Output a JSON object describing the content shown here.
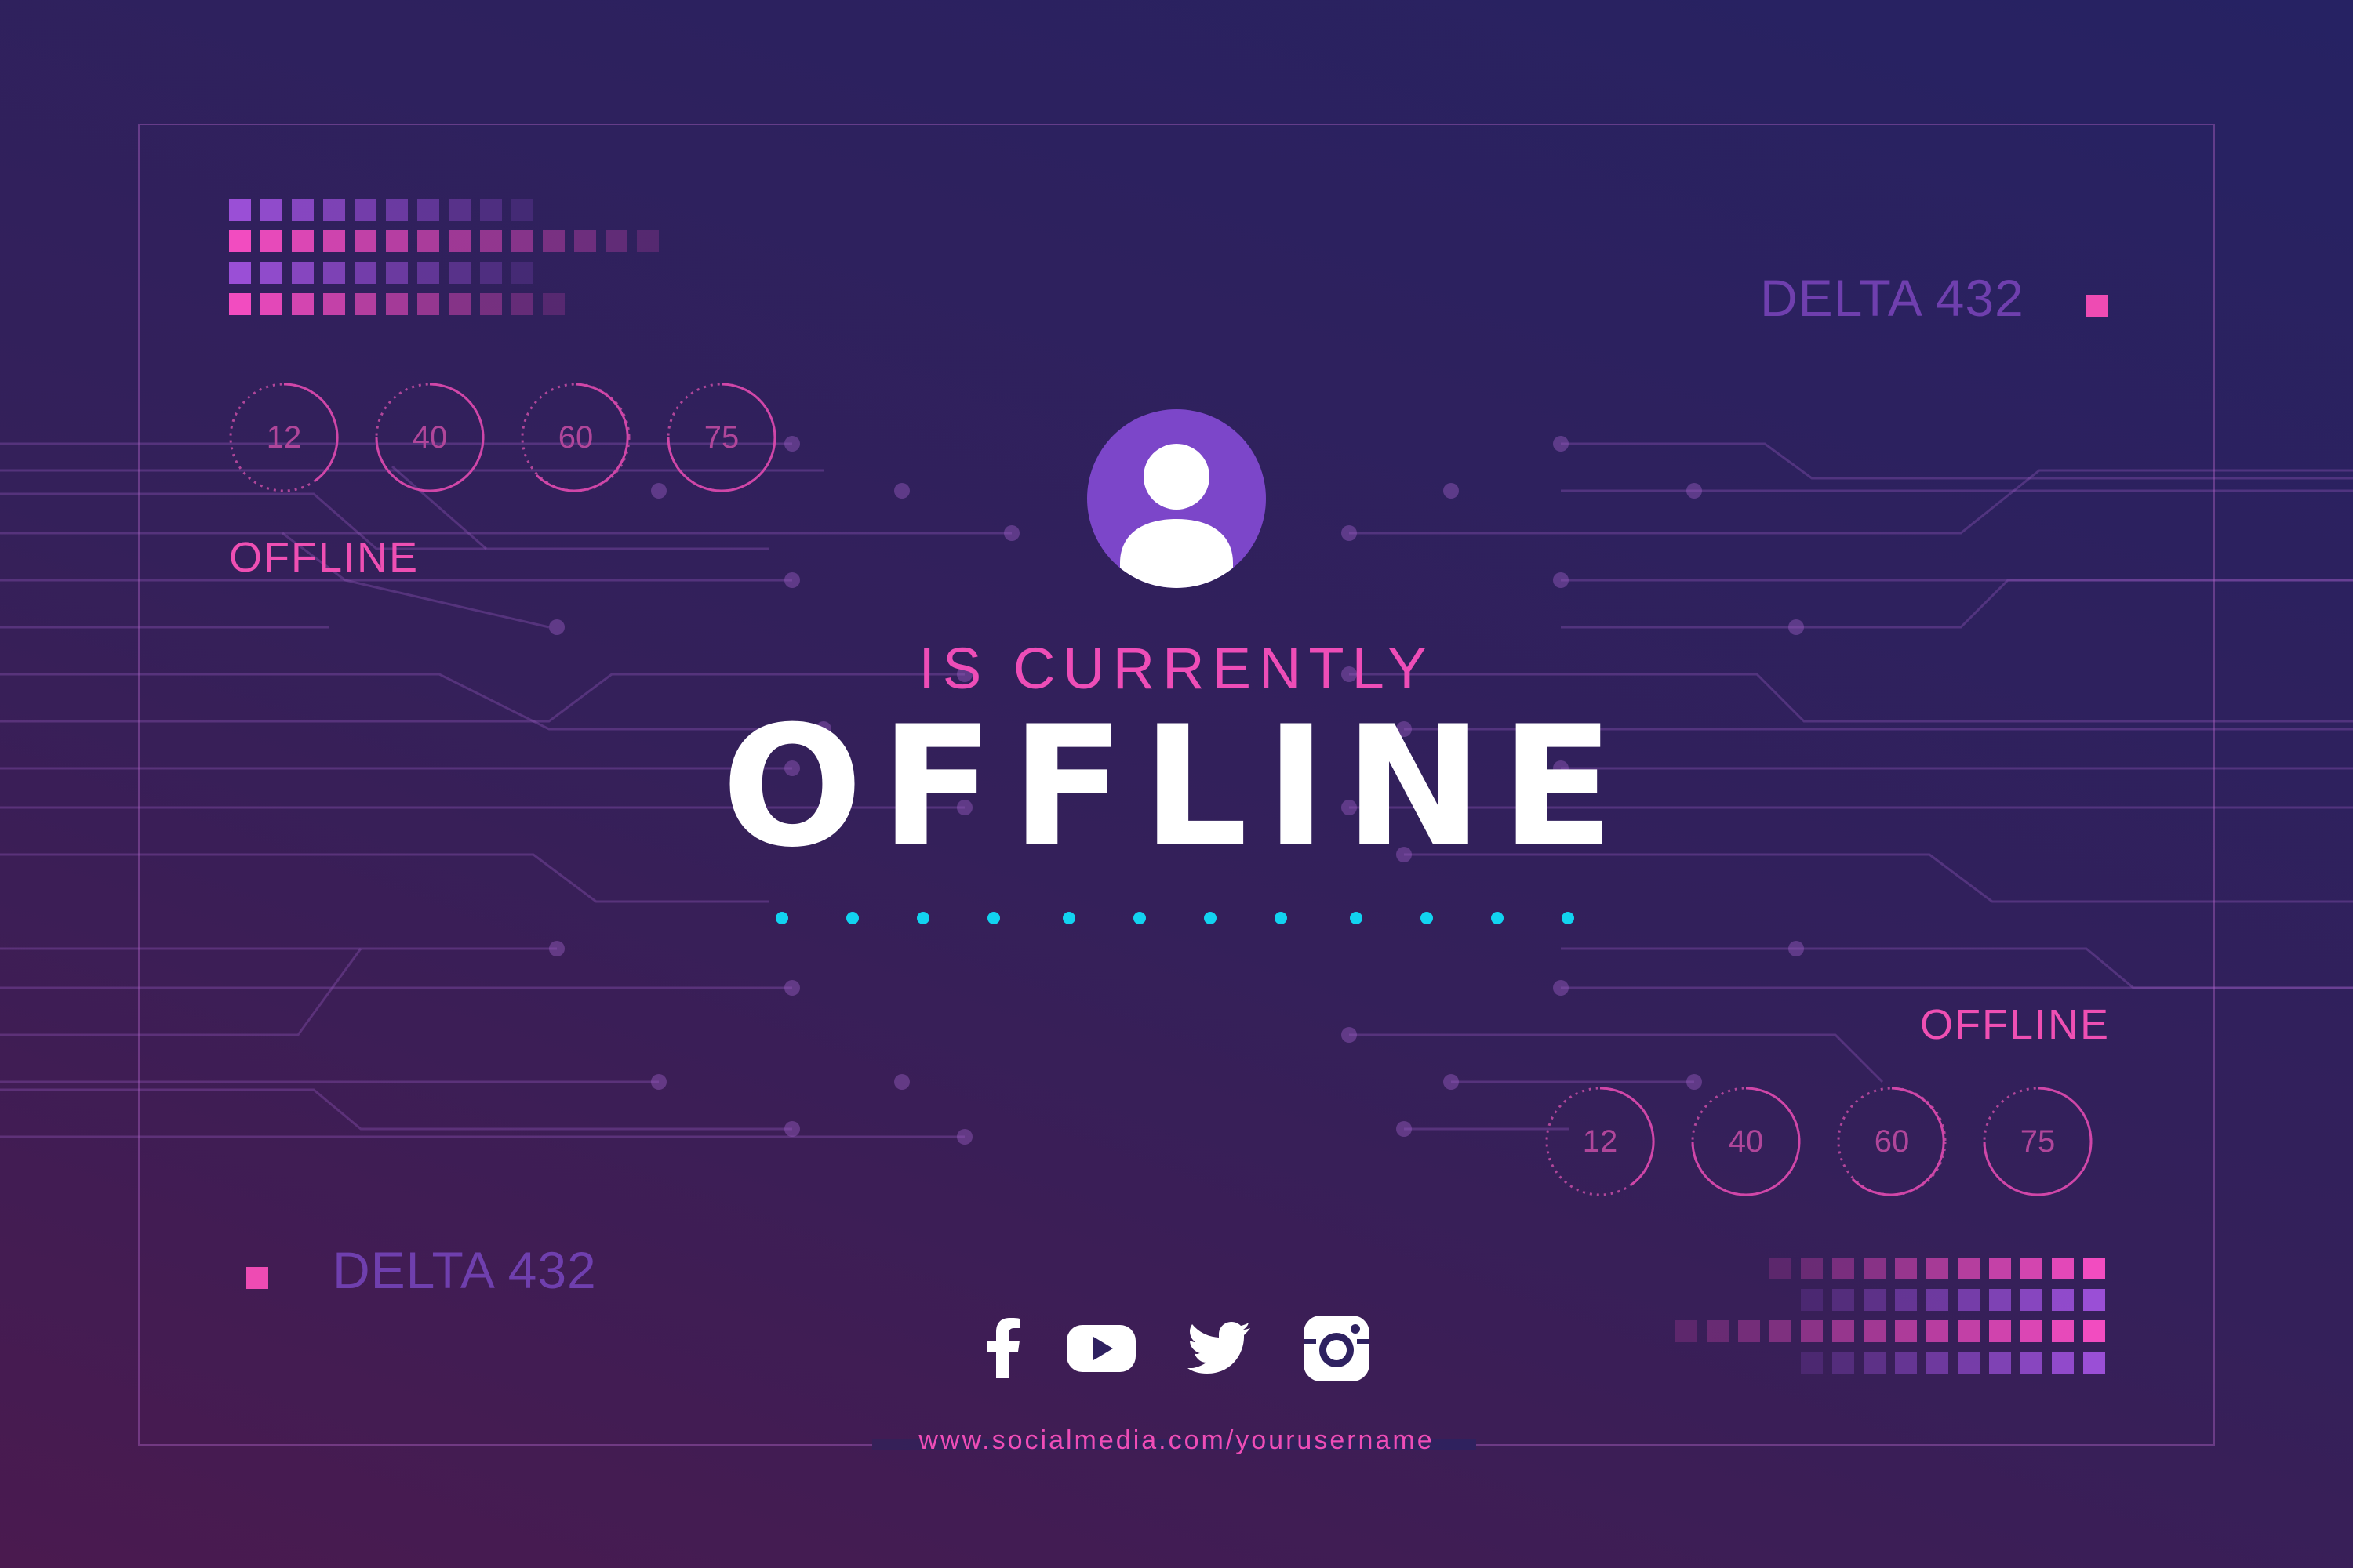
{
  "colors": {
    "accent_pink": "#ee4db7",
    "accent_purple": "#7c46c9",
    "accent_cyan": "#12d3f0",
    "muted_purple": "#6f3fae"
  },
  "header": {
    "subtitle": "IS CURRENTLY",
    "title": "OFFLINE"
  },
  "top_left": {
    "status": "OFFLINE",
    "dials": [
      "12",
      "40",
      "60",
      "75"
    ]
  },
  "top_right": {
    "label": "DELTA 432"
  },
  "bottom_right": {
    "status": "OFFLINE",
    "dials": [
      "12",
      "40",
      "60",
      "75"
    ]
  },
  "bottom_left": {
    "label": "DELTA 432"
  },
  "social": {
    "icons": [
      "facebook-icon",
      "youtube-icon",
      "twitter-icon",
      "instagram-icon"
    ],
    "url": "www.socialmedia.com/yourusername"
  },
  "avatar": {
    "icon": "user-icon"
  }
}
